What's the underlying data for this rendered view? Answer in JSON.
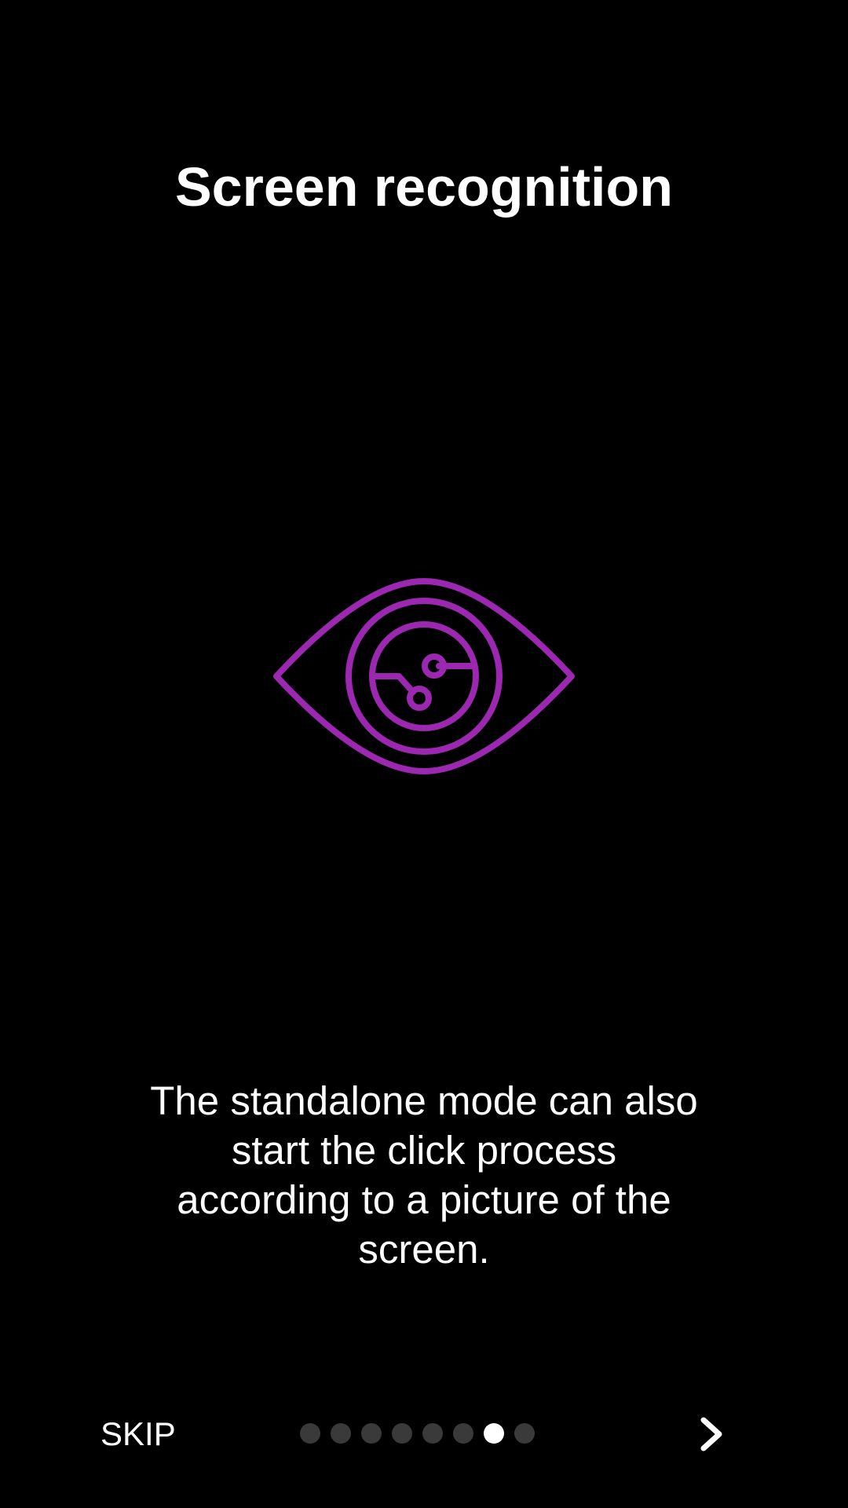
{
  "onboarding": {
    "title": "Screen recognition",
    "description": "The standalone mode can also start the click process according to a picture of the screen.",
    "illustration_icon": "eye-circuit-icon",
    "accent_color": "#9c27b0"
  },
  "footer": {
    "skip_label": "SKIP",
    "next_icon": "chevron-right-icon",
    "page_count": 8,
    "current_page": 7,
    "dot_active_color": "#ffffff",
    "dot_inactive_color": "#3a3a3a"
  }
}
